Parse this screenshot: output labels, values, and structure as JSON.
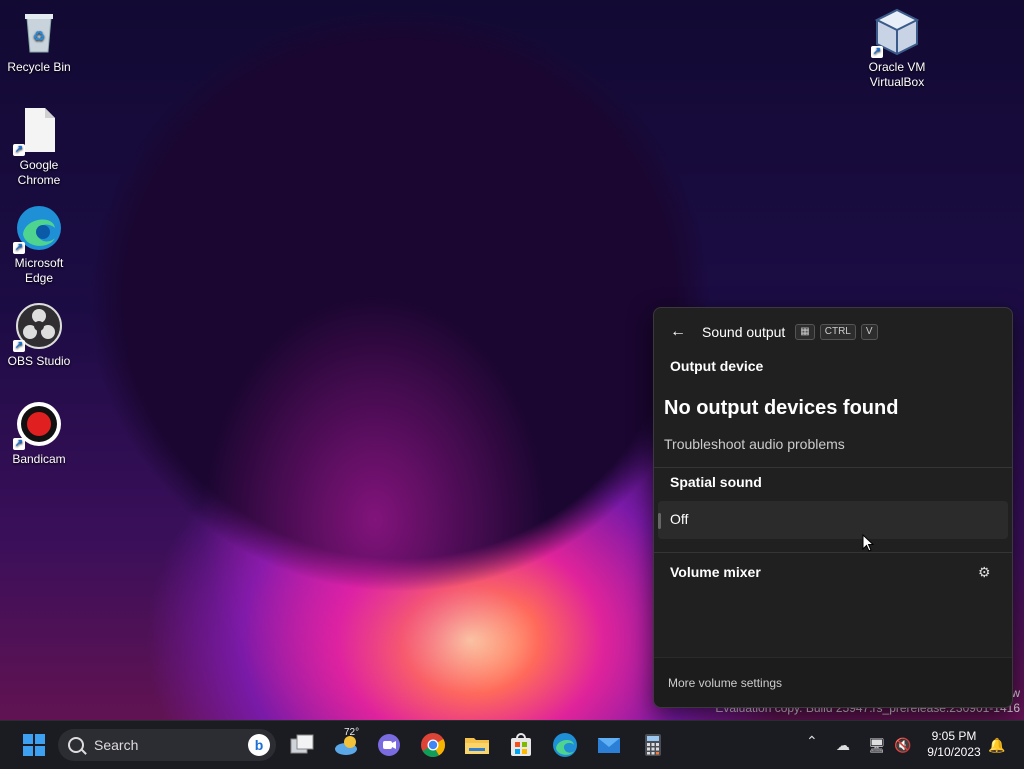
{
  "desktop": {
    "icons": [
      {
        "label": "Recycle Bin"
      },
      {
        "label": "Google Chrome"
      },
      {
        "label": "Microsoft Edge"
      },
      {
        "label": "OBS Studio"
      },
      {
        "label": "Bandicam"
      },
      {
        "label": "Oracle VM VirtualBox"
      }
    ],
    "watermark_line1": "w",
    "watermark_line2": "Evaluation copy. Build 25947.rs_prerelease.230901-1416"
  },
  "sound_panel": {
    "title": "Sound output",
    "shortcut_keys": [
      "CTRL",
      "V"
    ],
    "output_device_heading": "Output device",
    "no_devices_text": "No output devices found",
    "troubleshoot_link": "Troubleshoot audio problems",
    "spatial_sound_heading": "Spatial sound",
    "spatial_sound_value": "Off",
    "volume_mixer_heading": "Volume mixer",
    "more_settings_link": "More volume settings"
  },
  "taskbar": {
    "search_placeholder": "Search",
    "weather_temp": "72°",
    "time": "9:05 PM",
    "date": "9/10/2023"
  }
}
